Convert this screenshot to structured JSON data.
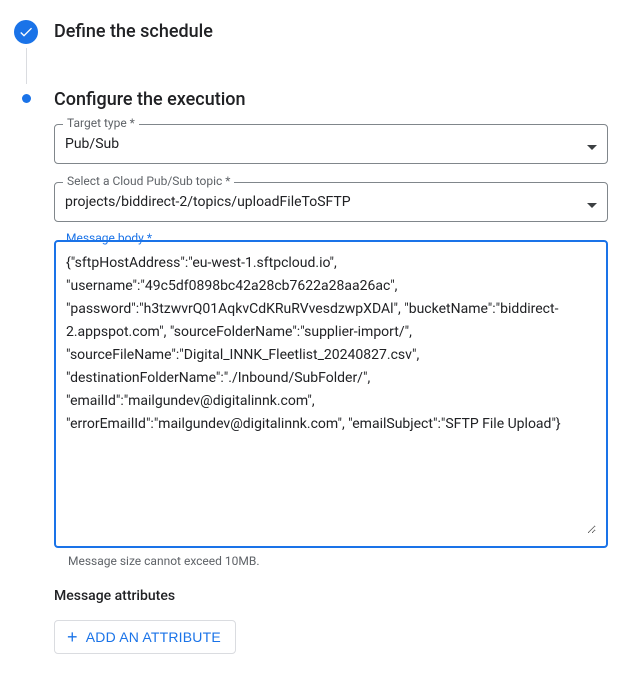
{
  "step1": {
    "title": "Define the schedule"
  },
  "step2": {
    "title": "Configure the execution"
  },
  "fields": {
    "targetType": {
      "label": "Target type *",
      "value": "Pub/Sub"
    },
    "topic": {
      "label": "Select a Cloud Pub/Sub topic *",
      "value": "projects/biddirect-2/topics/uploadFileToSFTP"
    },
    "messageBody": {
      "label": "Message body *",
      "value": "{\"sftpHostAddress\":\"eu-west-1.sftpcloud.io\", \"username\":\"49c5df0898bc42a28cb7622a28aa26ac\", \"password\":\"h3tzwvrQ01AqkvCdKRuRVvesdzwpXDAl\", \"bucketName\":\"biddirect-2.appspot.com\", \"sourceFolderName\":\"supplier-import/\", \"sourceFileName\":\"Digital_INNK_Fleetlist_20240827.csv\", \"destinationFolderName\":\"./Inbound/SubFolder/\", \"emailId\":\"mailgundev@digitalinnk.com\", \"errorEmailId\":\"mailgundev@digitalinnk.com\", \"emailSubject\":\"SFTP File Upload\"}",
      "helper": "Message size cannot exceed 10MB."
    }
  },
  "attributes": {
    "heading": "Message attributes",
    "buttonLabel": "ADD AN ATTRIBUTE"
  }
}
